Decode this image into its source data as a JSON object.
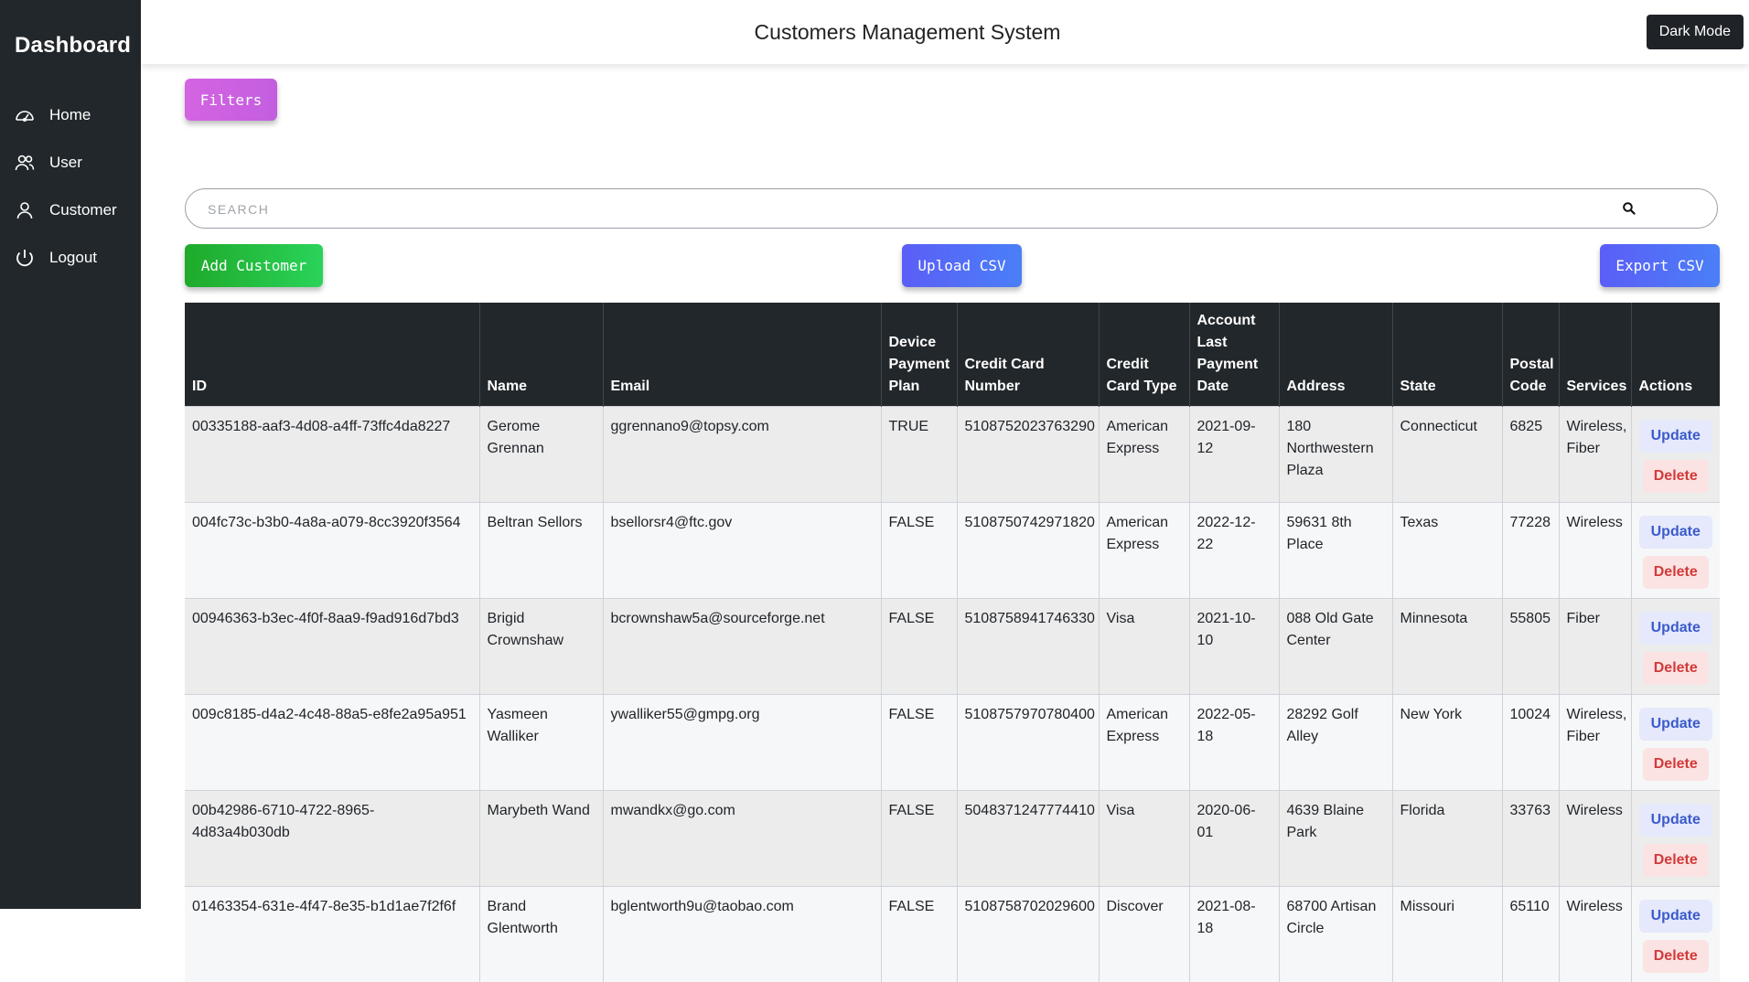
{
  "sidebar": {
    "brand": "Dashboard",
    "items": [
      {
        "label": "Home",
        "icon": "dashboard-gauge-icon"
      },
      {
        "label": "User",
        "icon": "users-icon"
      },
      {
        "label": "Customer",
        "icon": "person-icon"
      },
      {
        "label": "Logout",
        "icon": "power-icon"
      }
    ]
  },
  "header": {
    "title": "Customers Management System",
    "dark_mode_label": "Dark Mode"
  },
  "toolbar": {
    "filters_label": "Filters",
    "add_label": "Add Customer",
    "upload_label": "Upload CSV",
    "export_label": "Export CSV"
  },
  "search": {
    "placeholder": "SEARCH",
    "value": ""
  },
  "table": {
    "columns": [
      "ID",
      "Name",
      "Email",
      "Device Payment Plan",
      "Credit Card Number",
      "Credit Card Type",
      "Account Last Payment Date",
      "Address",
      "State",
      "Postal Code",
      "Services",
      "Actions"
    ],
    "update_label": "Update",
    "delete_label": "Delete",
    "rows": [
      [
        "00335188-aaf3-4d08-a4ff-73ffc4da8227",
        "Gerome Grennan",
        "ggrennano9@topsy.com",
        "TRUE",
        "5108752023763290",
        "American Express",
        "2021-09-12",
        "180 Northwestern Plaza",
        "Connecticut",
        "6825",
        "Wireless, Fiber"
      ],
      [
        "004fc73c-b3b0-4a8a-a079-8cc3920f3564",
        "Beltran Sellors",
        "bsellorsr4@ftc.gov",
        "FALSE",
        "5108750742971820",
        "American Express",
        "2022-12-22",
        "59631 8th Place",
        "Texas",
        "77228",
        "Wireless"
      ],
      [
        "00946363-b3ec-4f0f-8aa9-f9ad916d7bd3",
        "Brigid Crownshaw",
        "bcrownshaw5a@sourceforge.net",
        "FALSE",
        "5108758941746330",
        "Visa",
        "2021-10-10",
        "088 Old Gate Center",
        "Minnesota",
        "55805",
        "Fiber"
      ],
      [
        "009c8185-d4a2-4c48-88a5-e8fe2a95a951",
        "Yasmeen Walliker",
        "ywalliker55@gmpg.org",
        "FALSE",
        "5108757970780400",
        "American Express",
        "2022-05-18",
        "28292 Golf Alley",
        "New York",
        "10024",
        "Wireless, Fiber"
      ],
      [
        "00b42986-6710-4722-8965-4d83a4b030db",
        "Marybeth Wand",
        "mwandkx@go.com",
        "FALSE",
        "5048371247774410",
        "Visa",
        "2020-06-01",
        "4639 Blaine Park",
        "Florida",
        "33763",
        "Wireless"
      ],
      [
        "01463354-631e-4f47-8e35-b1d1ae7f2f6f",
        "Brand Glentworth",
        "bglentworth9u@taobao.com",
        "FALSE",
        "5108758702029600",
        "Discover",
        "2021-08-18",
        "68700 Artisan Circle",
        "Missouri",
        "65110",
        "Wireless"
      ]
    ]
  }
}
